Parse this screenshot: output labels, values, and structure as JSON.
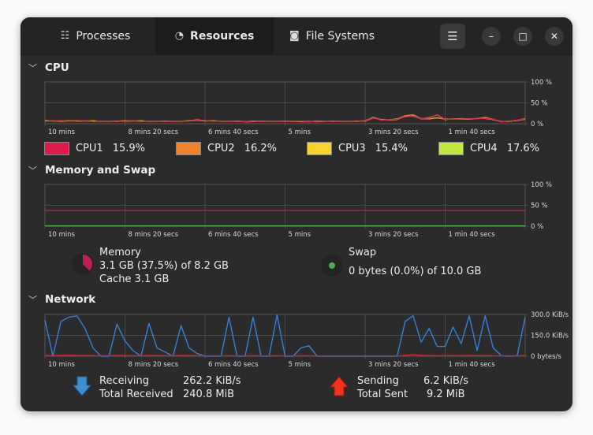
{
  "tabs": [
    {
      "label": "Processes",
      "icon": "list-icon"
    },
    {
      "label": "Resources",
      "icon": "gauge-icon",
      "active": true
    },
    {
      "label": "File Systems",
      "icon": "disk-icon"
    }
  ],
  "window_controls": {
    "menu": "☰",
    "minimize": "–",
    "maximize": "□",
    "close": "✕"
  },
  "time_labels": [
    "10 mins",
    "8 mins 20 secs",
    "6 mins 40 secs",
    "5 mins",
    "3 mins 20 secs",
    "1 min 40 secs"
  ],
  "cpu": {
    "title": "CPU",
    "y_labels": [
      "100 %",
      "50 %",
      "0 %"
    ],
    "legend": [
      {
        "name": "CPU1",
        "value": "15.9%",
        "color": "#e01b4c"
      },
      {
        "name": "CPU2",
        "value": "16.2%",
        "color": "#f3822f"
      },
      {
        "name": "CPU3",
        "value": "15.4%",
        "color": "#f6d32d"
      },
      {
        "name": "CPU4",
        "value": "17.6%",
        "color": "#c0e840"
      }
    ],
    "series": [
      [
        8,
        7,
        7,
        7,
        6,
        7,
        7,
        6,
        6,
        6,
        6,
        7,
        7,
        6,
        6,
        6,
        6,
        6,
        7,
        8,
        7,
        7,
        6,
        6,
        6,
        5,
        5,
        6,
        6,
        6,
        6,
        6,
        6,
        5,
        5,
        6,
        6,
        6,
        6,
        6,
        7,
        14,
        9,
        9,
        10,
        17,
        19,
        12,
        14,
        22,
        10,
        11,
        11,
        11,
        12,
        13,
        10,
        5,
        6,
        8,
        12
      ],
      [
        7,
        7,
        6,
        7,
        7,
        7,
        6,
        6,
        6,
        6,
        7,
        7,
        6,
        6,
        6,
        6,
        6,
        6,
        7,
        9,
        7,
        7,
        6,
        6,
        6,
        5,
        6,
        6,
        6,
        6,
        6,
        6,
        5,
        5,
        6,
        6,
        6,
        6,
        6,
        6,
        7,
        15,
        10,
        9,
        11,
        19,
        21,
        12,
        12,
        14,
        11,
        11,
        12,
        11,
        12,
        15,
        10,
        5,
        6,
        8,
        11
      ]
    ]
  },
  "memory": {
    "title": "Memory and Swap",
    "y_labels": [
      "100 %",
      "50 %",
      "0 %"
    ],
    "memory_percent": 37.5,
    "swap_percent": 0,
    "memory_color": "#c01c5c",
    "swap_color": "#4caf50",
    "memory_label": "Memory",
    "memory_used": "3.1 GB (37.5%) of 8.2 GB",
    "cache": "Cache 3.1 GB",
    "swap_label": "Swap",
    "swap_used": "0 bytes (0.0%) of 10.0 GB"
  },
  "network": {
    "title": "Network",
    "y_labels": [
      "300.0 KiB/s",
      "150.0 KiB/s",
      "0 bytes/s"
    ],
    "receive_color": "#3584e4",
    "send_color": "#e01b24",
    "receiving_label": "Receiving",
    "receiving_value": "262.2 KiB/s",
    "total_received_label": "Total Received",
    "total_received_value": "240.8 MiB",
    "sending_label": "Sending",
    "sending_value": "6.2 KiB/s",
    "total_sent_label": "Total Sent",
    "total_sent_value": "9.2 MiB",
    "receiving": [
      260,
      0,
      250,
      280,
      290,
      200,
      60,
      0,
      0,
      230,
      110,
      40,
      0,
      235,
      60,
      30,
      0,
      220,
      60,
      20,
      0,
      0,
      0,
      280,
      0,
      0,
      280,
      0,
      0,
      295,
      0,
      0,
      60,
      75,
      0,
      0,
      0,
      0,
      0,
      0,
      0,
      0,
      0,
      0,
      0,
      250,
      290,
      100,
      200,
      70,
      70,
      210,
      90,
      290,
      40,
      290,
      60,
      5,
      0,
      5,
      280
    ],
    "sending": [
      5,
      6,
      6,
      7,
      6,
      5,
      5,
      4,
      4,
      6,
      5,
      4,
      4,
      6,
      5,
      4,
      4,
      6,
      5,
      4,
      3,
      3,
      3,
      5,
      3,
      3,
      5,
      3,
      3,
      5,
      3,
      3,
      4,
      4,
      2,
      2,
      2,
      2,
      2,
      2,
      2,
      2,
      2,
      2,
      2,
      6,
      10,
      6,
      5,
      4,
      4,
      5,
      4,
      6,
      4,
      5,
      4,
      3,
      3,
      3,
      6
    ]
  }
}
